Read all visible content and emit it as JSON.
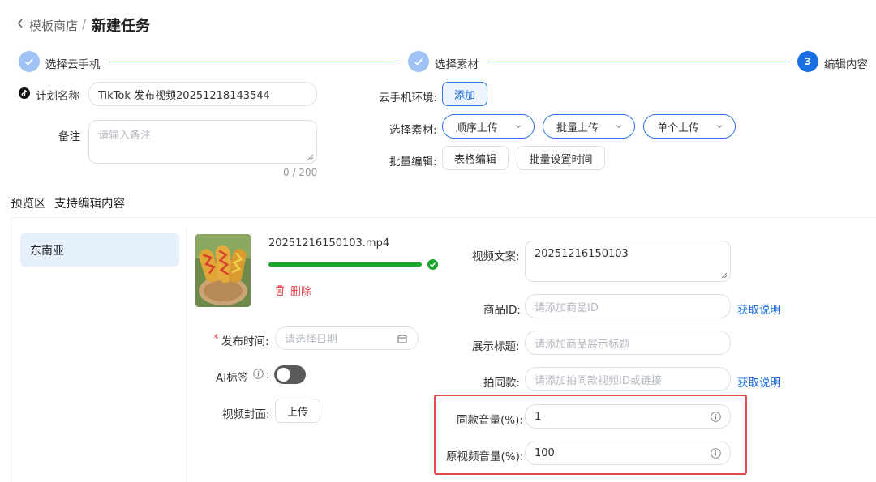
{
  "header": {
    "breadcrumb_parent": "模板商店",
    "breadcrumb_sep": "/",
    "page_title": "新建任务"
  },
  "steps": [
    {
      "label": "选择云手机",
      "status": "done"
    },
    {
      "label": "选择素材",
      "status": "done"
    },
    {
      "label": "编辑内容",
      "status": "active",
      "number": "3"
    }
  ],
  "form": {
    "plan_name_label": "计划名称",
    "plan_name_value": "TikTok 发布视频20251218143544",
    "remark_label": "备注",
    "remark_placeholder": "请输入备注",
    "remark_counter": "0 / 200",
    "env_label": "云手机环境:",
    "env_add_button": "添加",
    "material_label": "选择素材:",
    "material_options": [
      "顺序上传",
      "批量上传",
      "单个上传"
    ],
    "batch_label": "批量编辑:",
    "batch_buttons": [
      "表格编辑",
      "批量设置时间"
    ]
  },
  "preview": {
    "title": "预览区",
    "subtitle": "支持编辑内容",
    "regions": [
      "东南亚"
    ],
    "video": {
      "filename": "20251216150103.mp4",
      "progress": 1.0,
      "delete_label": "删除"
    },
    "publish_time_required": "*",
    "publish_time_label": "发布时间:",
    "publish_time_placeholder": "请选择日期",
    "ai_label": "AI标签",
    "ai_label_colon": ":",
    "ai_toggle_on": false,
    "cover_label": "视频封面:",
    "cover_upload": "上传",
    "caption_label": "视频文案:",
    "caption_value": "20251216150103",
    "product_id_label": "商品ID:",
    "product_id_placeholder": "请添加商品ID",
    "product_id_help": "获取说明",
    "display_title_label": "展示标题:",
    "display_title_placeholder": "请添加商品展示标题",
    "same_style_label": "拍同款:",
    "same_style_placeholder": "请添加拍同款视频ID或链接",
    "same_style_help": "获取说明",
    "same_volume_label": "同款音量(%):",
    "same_volume_value": "1",
    "orig_volume_label": "原视频音量(%):",
    "orig_volume_value": "100"
  },
  "colors": {
    "primary": "#1a6fe3",
    "step_done": "#9fc3f4",
    "progress": "#1aa52c",
    "danger": "#e5484d",
    "highlight_box": "#e5484d"
  }
}
